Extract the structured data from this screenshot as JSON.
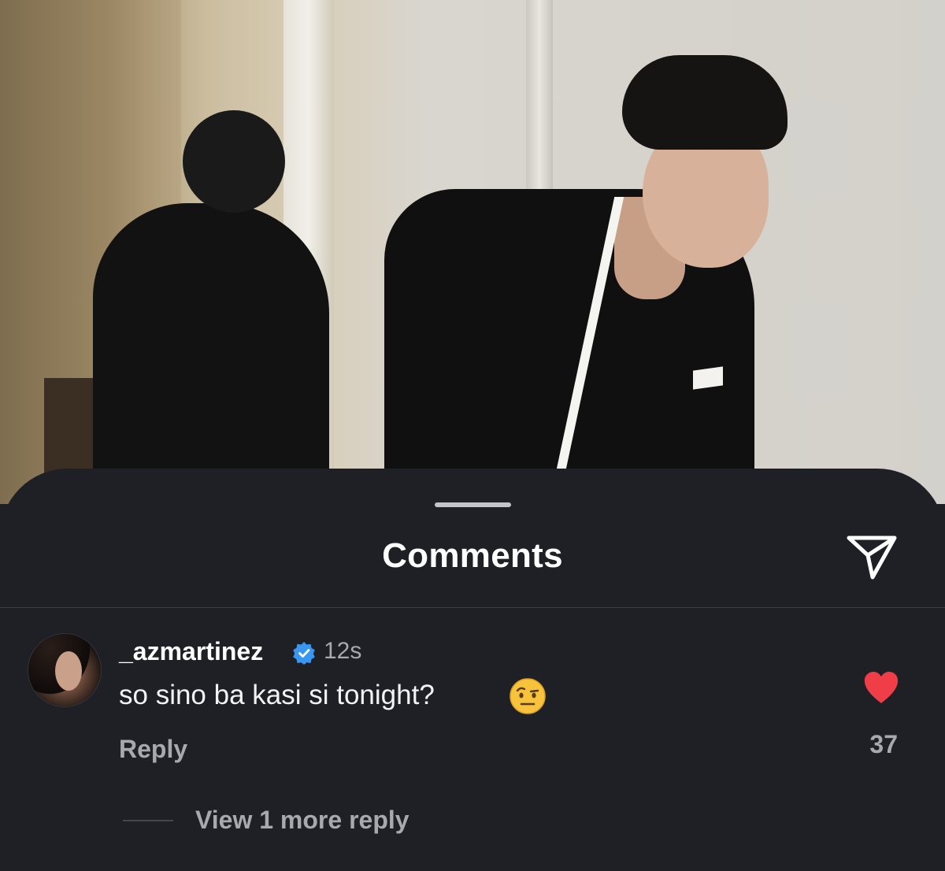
{
  "sheet": {
    "title": "Comments"
  },
  "comment": {
    "username": "_azmartinez",
    "timestamp": "12s",
    "text": "so sino ba kasi si tonight?",
    "emoji": "raised-eyebrow-face",
    "reply_label": "Reply",
    "likes": "37",
    "liked": true,
    "view_more_label": "View 1 more reply"
  },
  "colors": {
    "sheet_background": "#1e2026",
    "like_red": "#f03e48",
    "verified_blue": "#3897f0",
    "secondary_text": "#a8a9ae"
  },
  "icons": [
    "share-send-icon",
    "verified-badge-icon",
    "heart-icon"
  ]
}
